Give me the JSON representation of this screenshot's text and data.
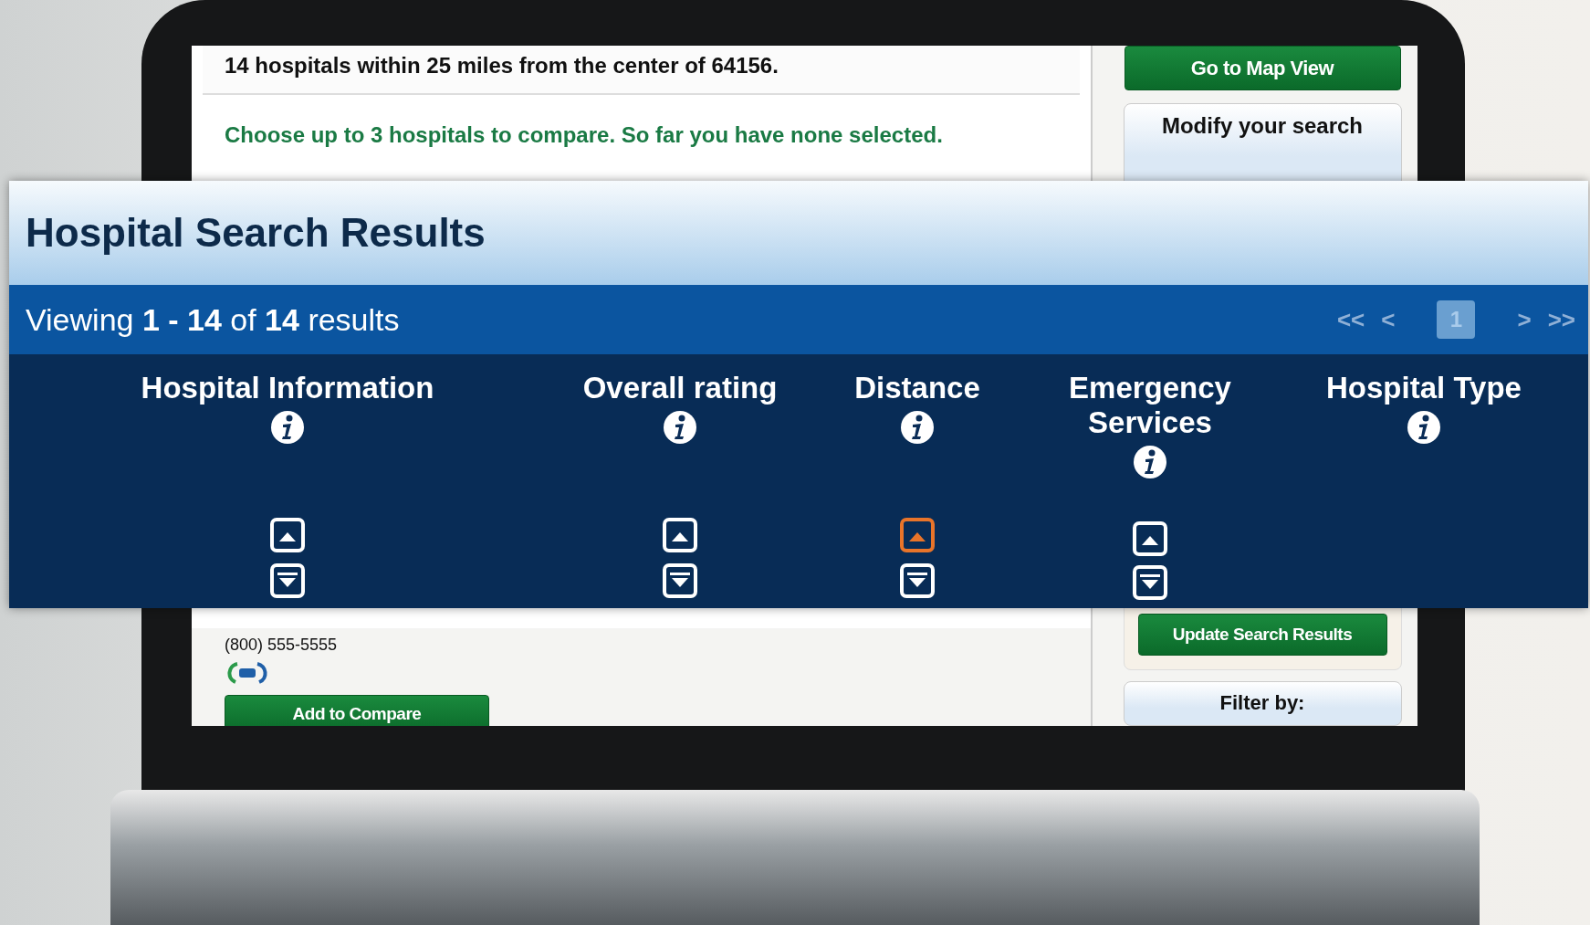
{
  "screen": {
    "summary": "14 hospitals within 25 miles from the center of 64156.",
    "compare_note": "Choose up to 3 hospitals to compare.  So far you have none selected.",
    "hospital": {
      "phone": "(800) 555-5555",
      "add_button": "Add to Compare"
    },
    "sidebar": {
      "map_button": "Go to Map View",
      "modify_heading": "Modify your search",
      "update_button": "Update Search Results",
      "filter_heading": "Filter by:"
    }
  },
  "results": {
    "title": "Hospital Search Results",
    "viewing": "Viewing **1 - 14** of **14** results",
    "pagination": [
      {
        "label": "<<",
        "kind": "nav",
        "selected": false
      },
      {
        "label": "<",
        "kind": "nav",
        "selected": false
      },
      {
        "label": "1",
        "kind": "page",
        "selected": true
      },
      {
        "label": ">",
        "kind": "nav",
        "selected": false
      },
      {
        "label": ">>",
        "kind": "nav",
        "selected": false
      }
    ],
    "columns": [
      {
        "label": "Hospital Information",
        "sort_buttons": [
          {
            "kind": "up",
            "active": false
          },
          {
            "kind": "down",
            "active": false
          }
        ]
      },
      {
        "label": "Overall rating",
        "sort_buttons": [
          {
            "kind": "up",
            "active": false
          },
          {
            "kind": "down",
            "active": false
          }
        ]
      },
      {
        "label": "Distance",
        "sort_buttons": [
          {
            "kind": "up",
            "active": true
          },
          {
            "kind": "down",
            "active": false
          }
        ]
      },
      {
        "label": "Emergency Services",
        "sort_buttons": [
          {
            "kind": "up",
            "active": false
          },
          {
            "kind": "down",
            "active": false
          }
        ]
      },
      {
        "label": "Hospital Type"
      }
    ]
  }
}
